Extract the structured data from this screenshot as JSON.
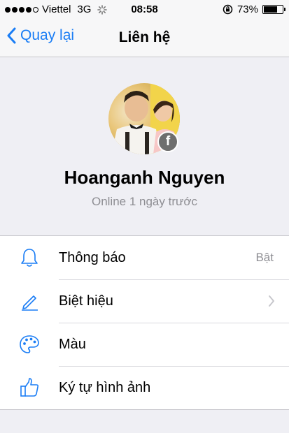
{
  "status_bar": {
    "carrier": "Viettel",
    "network": "3G",
    "time": "08:58",
    "battery": "73%",
    "battery_level": 0.73
  },
  "nav": {
    "back_label": "Quay lại",
    "title": "Liên hệ"
  },
  "profile": {
    "name": "Hoanganh Nguyen",
    "status": "Online 1 ngày trước",
    "badge": "f"
  },
  "menu": {
    "items": [
      {
        "label": "Thông báo",
        "value": "Bật",
        "icon": "bell-icon"
      },
      {
        "label": "Biệt hiệu",
        "icon": "pencil-icon"
      },
      {
        "label": "Màu",
        "icon": "palette-icon"
      },
      {
        "label": "Ký tự hình ảnh",
        "icon": "thumbs-up-icon"
      }
    ]
  },
  "colors": {
    "accent": "#1a7df5",
    "background": "#efeff4",
    "secondary_text": "#8e8e93"
  }
}
